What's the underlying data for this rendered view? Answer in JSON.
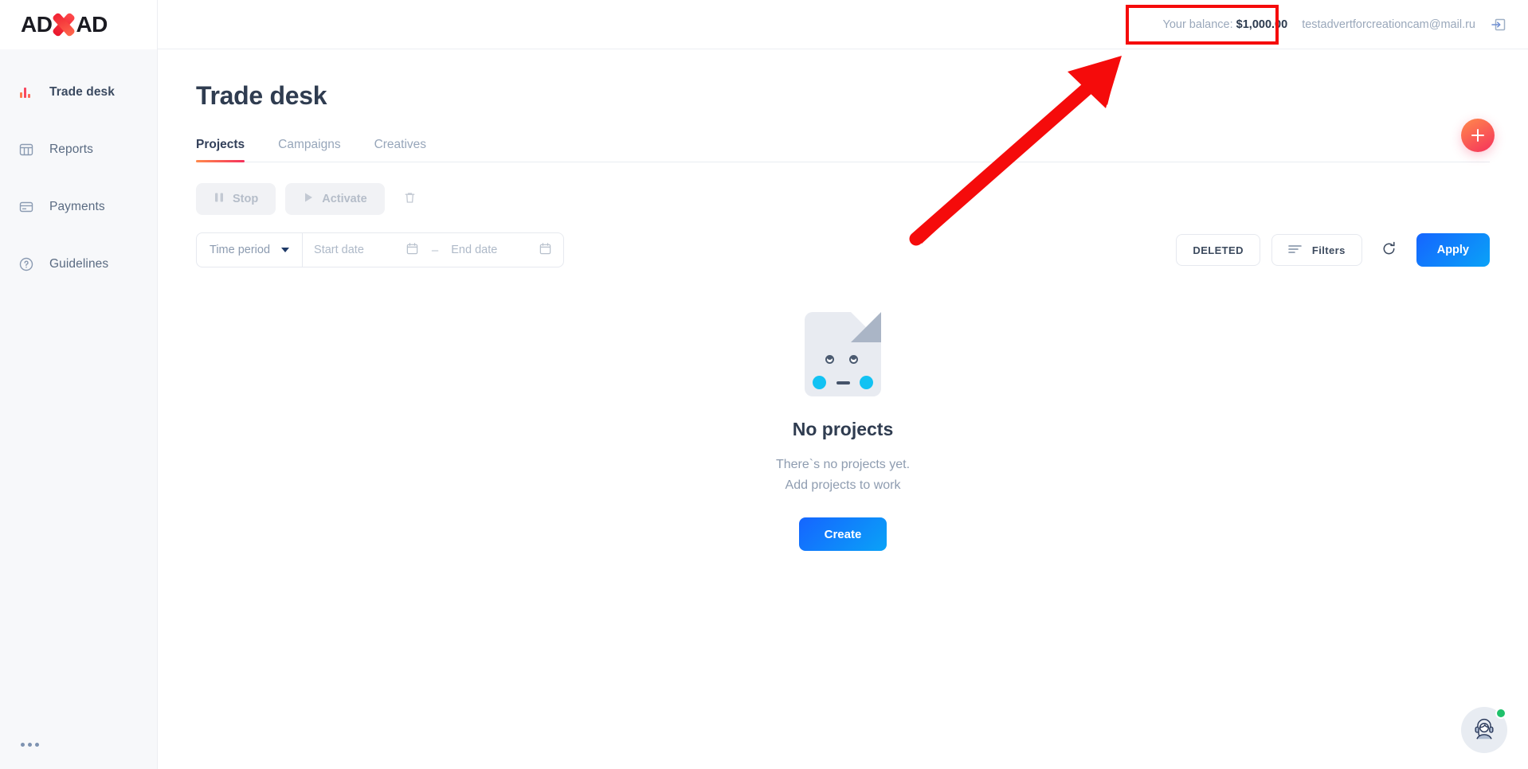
{
  "brand": {
    "logo_left": "AD",
    "logo_right": "AD",
    "logo_mark": "x-mark",
    "accent_red": "#f5315c",
    "accent_orange": "#ff8a4c",
    "accent_blue": "#1565ff"
  },
  "topbar": {
    "balance_label": "Your balance:",
    "balance_value": "$1,000.00",
    "user_email": "testadvertforcreationcam@mail.ru",
    "logout_icon": "logout-icon"
  },
  "sidebar": {
    "items": [
      {
        "label": "Trade desk",
        "icon": "bar-chart-icon",
        "active": true
      },
      {
        "label": "Reports",
        "icon": "table-grid-icon",
        "active": false
      },
      {
        "label": "Payments",
        "icon": "credit-card-icon",
        "active": false
      },
      {
        "label": "Guidelines",
        "icon": "question-circle-icon",
        "active": false
      }
    ],
    "more_menu": "more-dots"
  },
  "page": {
    "title": "Trade desk"
  },
  "tabs": [
    {
      "label": "Projects",
      "active": true
    },
    {
      "label": "Campaigns",
      "active": false
    },
    {
      "label": "Creatives",
      "active": false
    }
  ],
  "fab": {
    "label": "+",
    "name": "add-project-fab"
  },
  "actions": {
    "stop_label": "Stop",
    "activate_label": "Activate",
    "delete_icon": "trash-icon",
    "disabled": true
  },
  "filters": {
    "time_period_label": "Time period",
    "start_date_placeholder": "Start date",
    "start_date_value": "",
    "end_date_placeholder": "End date",
    "end_date_value": "",
    "separator": "–",
    "deleted_label": "DELETED",
    "filters_label": "Filters",
    "refresh_icon": "refresh-icon",
    "apply_label": "Apply"
  },
  "empty_state": {
    "illustration": "empty-document-face",
    "title": "No projects",
    "line1": "There`s no projects yet.",
    "line2": "Add projects to work",
    "cta_label": "Create"
  },
  "support": {
    "icon": "headset-operator-icon",
    "status": "online"
  },
  "annotations": {
    "highlight_color": "#f50b0b",
    "highlight_target": "balance",
    "arrow": "red-arrow-pointing-to-balance"
  }
}
